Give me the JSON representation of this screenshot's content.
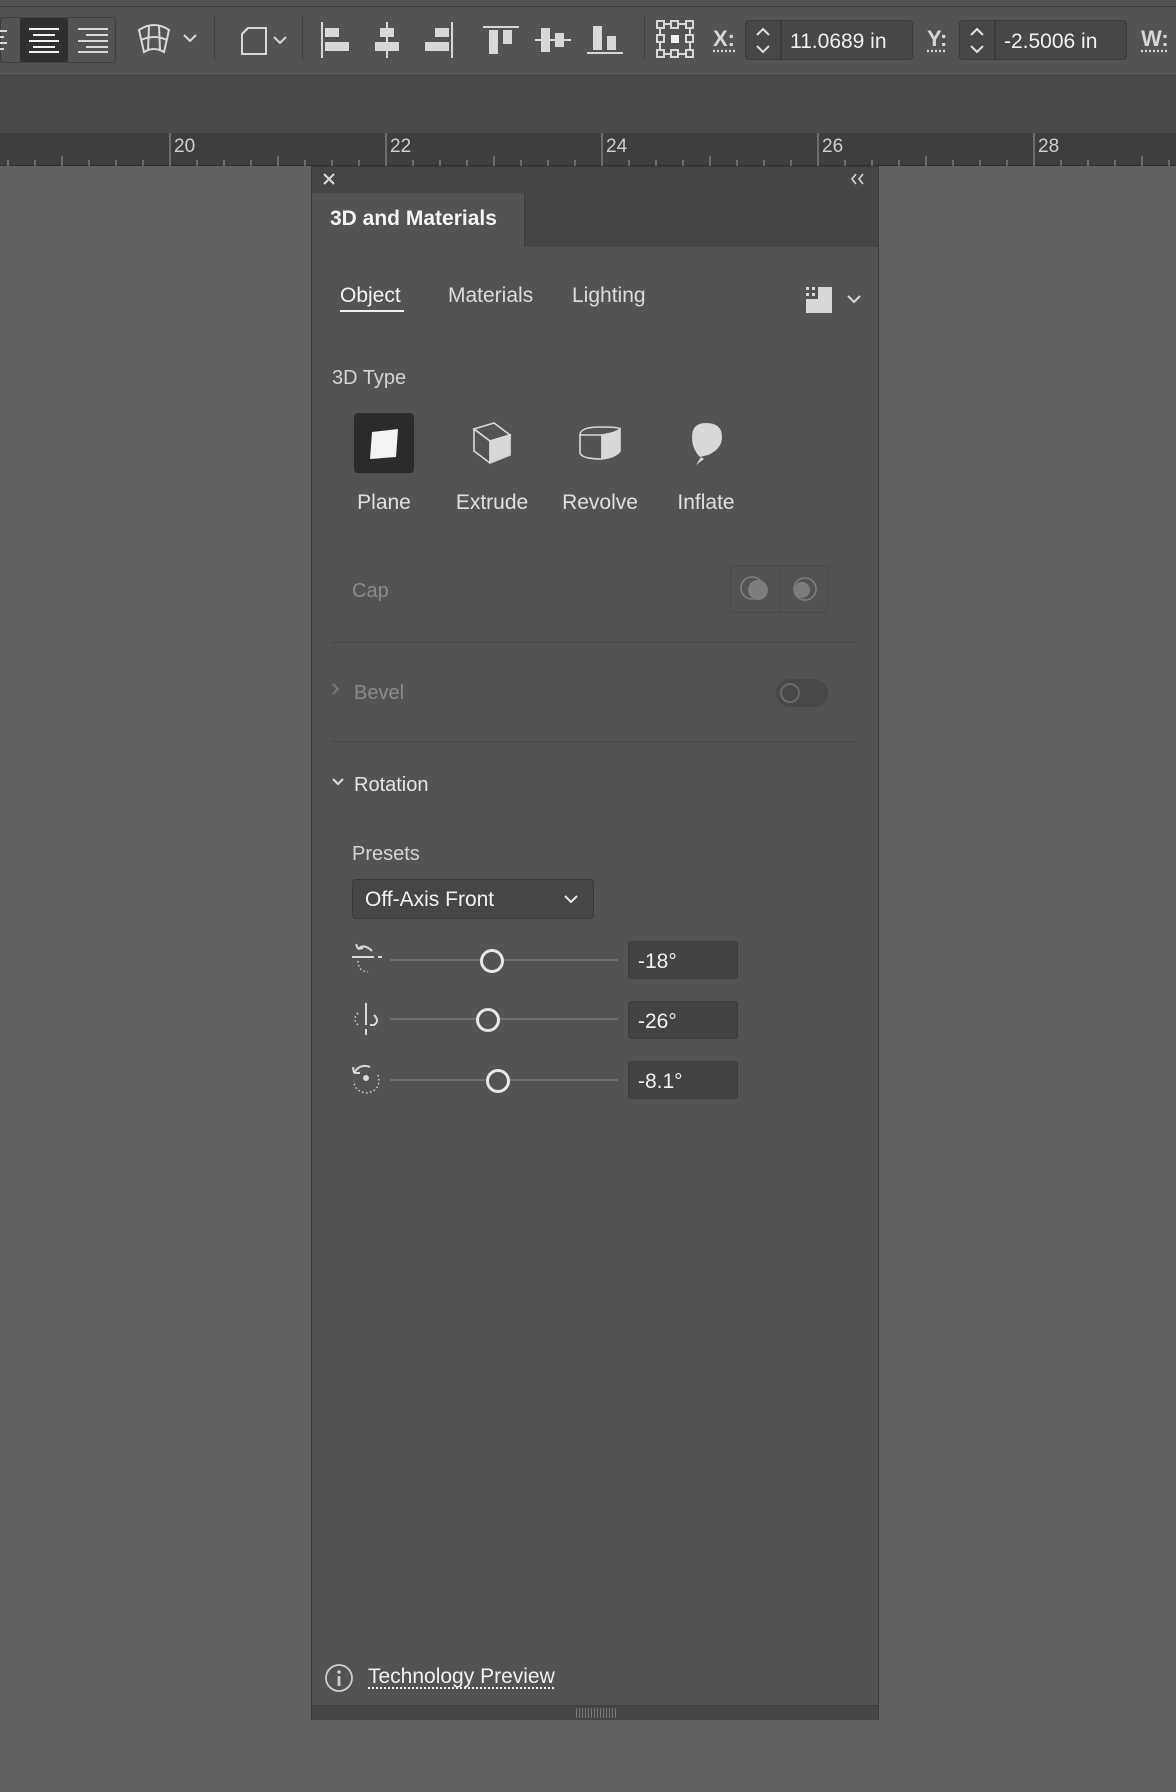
{
  "toolbar": {
    "x_label": "X:",
    "x_value": "11.0689 in",
    "y_label": "Y:",
    "y_value": "-2.5006 in",
    "w_label": "W:"
  },
  "ruler": {
    "labels": [
      "20",
      "22",
      "24",
      "26",
      "28"
    ]
  },
  "panel": {
    "title": "3D and Materials",
    "tabs": [
      "Object",
      "Materials",
      "Lighting"
    ],
    "active_tab": "Object",
    "type_section_label": "3D Type",
    "types": [
      {
        "label": "Plane",
        "icon": "plane-icon",
        "selected": true
      },
      {
        "label": "Extrude",
        "icon": "extrude-icon",
        "selected": false
      },
      {
        "label": "Revolve",
        "icon": "revolve-icon",
        "selected": false
      },
      {
        "label": "Inflate",
        "icon": "inflate-icon",
        "selected": false
      }
    ],
    "cap_label": "Cap",
    "bevel_label": "Bevel",
    "bevel_enabled": false,
    "rotation_label": "Rotation",
    "presets_label": "Presets",
    "preset_value": "Off-Axis Front",
    "rotations": [
      {
        "axis": "x",
        "value": "-18°",
        "degrees": -18
      },
      {
        "axis": "y",
        "value": "-26°",
        "degrees": -26
      },
      {
        "axis": "z",
        "value": "-8.1°",
        "degrees": -8.1
      }
    ],
    "footer_link": "Technology Preview"
  },
  "colors": {
    "canvas": "#616161",
    "panel": "#535353",
    "panel_dark": "#454545",
    "selected": "#2b2b2b",
    "text": "#e6e6e6"
  }
}
